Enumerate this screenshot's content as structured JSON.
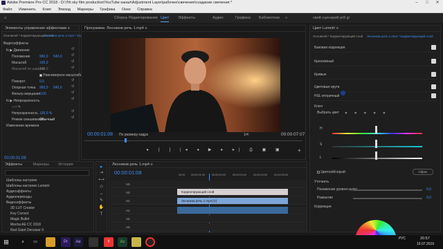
{
  "title_bar": {
    "text": "Adobe Premiere Pro CC 2018 - D:\\7th sky film production\\YouTube канал\\Adjustment Layer\\рабочее\\свечение\\создание свечения *"
  },
  "menu": [
    "Файл",
    "Изменить",
    "Клип",
    "Эпизод",
    "Маркеры",
    "Графика",
    "Окно",
    "Справка"
  ],
  "workspaces": [
    {
      "label": "Сборка"
    },
    {
      "label": "Редактирование"
    },
    {
      "label": "Цвет",
      "active": true
    },
    {
      "label": "Эффекты"
    },
    {
      "label": "Аудио"
    },
    {
      "label": "Графика"
    },
    {
      "label": "Библиотеки"
    },
    {
      "label": "»"
    },
    {
      "label": "свой сценарий pr8 gr"
    }
  ],
  "effect_controls": {
    "tab": "Элементы управления эффектами ≡",
    "header_left": "Основной * Корректирующий слой",
    "header_right": "Лесников речь 1.mp4 * Корректир...",
    "rows": [
      {
        "label": "Видеоэффекты"
      },
      {
        "label": "fx ▶ Движение"
      },
      {
        "label": "Положение",
        "v1": "960,0",
        "v2": "540,0"
      },
      {
        "label": "Масштаб",
        "v1": "100,0"
      },
      {
        "label": "Масштаб по ширине",
        "v1": "100,0"
      },
      {
        "label": "Равномерное масштабирование"
      },
      {
        "label": "Поворот",
        "v1": "0,0"
      },
      {
        "label": "Опорная точка",
        "v1": "960,0",
        "v2": "540,0"
      },
      {
        "label": "Фильтр мерцания",
        "v1": "0,00"
      },
      {
        "label": "fx ▶ Непрозрачность"
      },
      {
        "label": "Непрозрачность",
        "v1": "100,0 %"
      },
      {
        "label": "Режим смешивания",
        "v1": "Обычный"
      },
      {
        "label": "Изменение времени"
      }
    ],
    "timecode": "00:00:01:08"
  },
  "program": {
    "tab": "Программа: Лесников речь 1.mp4 ≡",
    "timecode_left": "00:00:01:08",
    "fit": "По размеру кадра",
    "fraction": "1/4",
    "timecode_right": "00:00:07:07"
  },
  "effects_panel": {
    "tabs": [
      "Эффекты",
      "Маркеры",
      "История"
    ],
    "items": [
      "Шаблоны настроек",
      "Шаблоны настроек Lumetri",
      "Аудиоэффекты",
      "Аудиопереходы",
      "Видеоэффекты",
      "3D LUT Creator",
      "Key Correct",
      "Magic Bullet",
      "Mocha AE CC 2018",
      "Red Giant Denoiser II",
      "Regarding SPG pro",
      "Видеоэффекты"
    ]
  },
  "timeline": {
    "tab": "Лесников речь 1.mp4 ≡",
    "timecode": "00:00:01:08",
    "ruler": [
      "00:00",
      "00:00:01:00",
      "00:00:02:00",
      "00:00:03:00",
      "00:00:04:00",
      "00:00:05:00"
    ],
    "tracks": [
      "V3",
      "V2",
      "V1",
      "A1",
      "A2",
      "A3"
    ],
    "clips": [
      {
        "label": "Корректирующий слой"
      },
      {
        "label": "Лесников речь 1.mp4 [V]"
      }
    ]
  },
  "lumetri": {
    "tab": "Цвет Lumetri ≡",
    "header_left": "Основной * Корректирующий слой",
    "header_right": "Лесников речь 1.mp4 * Корректирующий слой",
    "sections": [
      "Базовая коррекция",
      "Креативный",
      "Кривые",
      "Цветовые круги",
      "HSL-вторичный"
    ],
    "key": "Ключ",
    "pick_color": "Выбрать цвет",
    "hsl_labels": [
      "H",
      "S",
      "L"
    ],
    "color_gray": "Цветной/серый",
    "reset": "Сброс",
    "refine": "Уточнить",
    "denoise": {
      "label": "Понижение уровня шума",
      "value": "0,0"
    },
    "blur": {
      "label": "Размытие",
      "value": "0,0"
    },
    "correction": "Коррекция"
  },
  "taskbar": {
    "time": "20:57",
    "date": "19.07.2019",
    "lang": "РУС"
  }
}
